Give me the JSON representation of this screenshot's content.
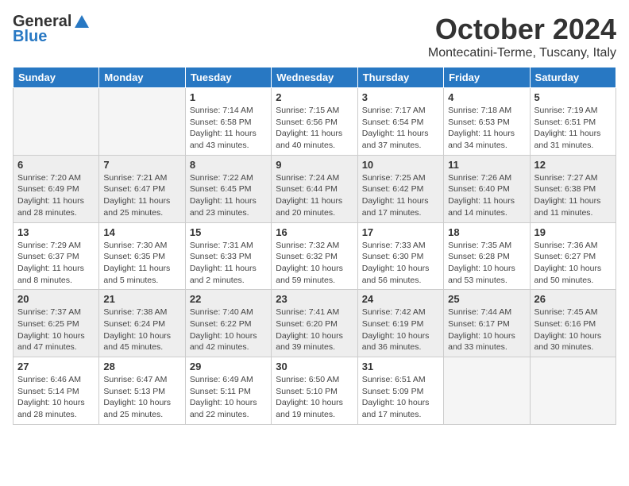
{
  "header": {
    "logo_general": "General",
    "logo_blue": "Blue",
    "month": "October 2024",
    "location": "Montecatini-Terme, Tuscany, Italy"
  },
  "columns": [
    "Sunday",
    "Monday",
    "Tuesday",
    "Wednesday",
    "Thursday",
    "Friday",
    "Saturday"
  ],
  "weeks": [
    [
      {
        "day": "",
        "info": ""
      },
      {
        "day": "",
        "info": ""
      },
      {
        "day": "1",
        "info": "Sunrise: 7:14 AM\nSunset: 6:58 PM\nDaylight: 11 hours and 43 minutes."
      },
      {
        "day": "2",
        "info": "Sunrise: 7:15 AM\nSunset: 6:56 PM\nDaylight: 11 hours and 40 minutes."
      },
      {
        "day": "3",
        "info": "Sunrise: 7:17 AM\nSunset: 6:54 PM\nDaylight: 11 hours and 37 minutes."
      },
      {
        "day": "4",
        "info": "Sunrise: 7:18 AM\nSunset: 6:53 PM\nDaylight: 11 hours and 34 minutes."
      },
      {
        "day": "5",
        "info": "Sunrise: 7:19 AM\nSunset: 6:51 PM\nDaylight: 11 hours and 31 minutes."
      }
    ],
    [
      {
        "day": "6",
        "info": "Sunrise: 7:20 AM\nSunset: 6:49 PM\nDaylight: 11 hours and 28 minutes."
      },
      {
        "day": "7",
        "info": "Sunrise: 7:21 AM\nSunset: 6:47 PM\nDaylight: 11 hours and 25 minutes."
      },
      {
        "day": "8",
        "info": "Sunrise: 7:22 AM\nSunset: 6:45 PM\nDaylight: 11 hours and 23 minutes."
      },
      {
        "day": "9",
        "info": "Sunrise: 7:24 AM\nSunset: 6:44 PM\nDaylight: 11 hours and 20 minutes."
      },
      {
        "day": "10",
        "info": "Sunrise: 7:25 AM\nSunset: 6:42 PM\nDaylight: 11 hours and 17 minutes."
      },
      {
        "day": "11",
        "info": "Sunrise: 7:26 AM\nSunset: 6:40 PM\nDaylight: 11 hours and 14 minutes."
      },
      {
        "day": "12",
        "info": "Sunrise: 7:27 AM\nSunset: 6:38 PM\nDaylight: 11 hours and 11 minutes."
      }
    ],
    [
      {
        "day": "13",
        "info": "Sunrise: 7:29 AM\nSunset: 6:37 PM\nDaylight: 11 hours and 8 minutes."
      },
      {
        "day": "14",
        "info": "Sunrise: 7:30 AM\nSunset: 6:35 PM\nDaylight: 11 hours and 5 minutes."
      },
      {
        "day": "15",
        "info": "Sunrise: 7:31 AM\nSunset: 6:33 PM\nDaylight: 11 hours and 2 minutes."
      },
      {
        "day": "16",
        "info": "Sunrise: 7:32 AM\nSunset: 6:32 PM\nDaylight: 10 hours and 59 minutes."
      },
      {
        "day": "17",
        "info": "Sunrise: 7:33 AM\nSunset: 6:30 PM\nDaylight: 10 hours and 56 minutes."
      },
      {
        "day": "18",
        "info": "Sunrise: 7:35 AM\nSunset: 6:28 PM\nDaylight: 10 hours and 53 minutes."
      },
      {
        "day": "19",
        "info": "Sunrise: 7:36 AM\nSunset: 6:27 PM\nDaylight: 10 hours and 50 minutes."
      }
    ],
    [
      {
        "day": "20",
        "info": "Sunrise: 7:37 AM\nSunset: 6:25 PM\nDaylight: 10 hours and 47 minutes."
      },
      {
        "day": "21",
        "info": "Sunrise: 7:38 AM\nSunset: 6:24 PM\nDaylight: 10 hours and 45 minutes."
      },
      {
        "day": "22",
        "info": "Sunrise: 7:40 AM\nSunset: 6:22 PM\nDaylight: 10 hours and 42 minutes."
      },
      {
        "day": "23",
        "info": "Sunrise: 7:41 AM\nSunset: 6:20 PM\nDaylight: 10 hours and 39 minutes."
      },
      {
        "day": "24",
        "info": "Sunrise: 7:42 AM\nSunset: 6:19 PM\nDaylight: 10 hours and 36 minutes."
      },
      {
        "day": "25",
        "info": "Sunrise: 7:44 AM\nSunset: 6:17 PM\nDaylight: 10 hours and 33 minutes."
      },
      {
        "day": "26",
        "info": "Sunrise: 7:45 AM\nSunset: 6:16 PM\nDaylight: 10 hours and 30 minutes."
      }
    ],
    [
      {
        "day": "27",
        "info": "Sunrise: 6:46 AM\nSunset: 5:14 PM\nDaylight: 10 hours and 28 minutes."
      },
      {
        "day": "28",
        "info": "Sunrise: 6:47 AM\nSunset: 5:13 PM\nDaylight: 10 hours and 25 minutes."
      },
      {
        "day": "29",
        "info": "Sunrise: 6:49 AM\nSunset: 5:11 PM\nDaylight: 10 hours and 22 minutes."
      },
      {
        "day": "30",
        "info": "Sunrise: 6:50 AM\nSunset: 5:10 PM\nDaylight: 10 hours and 19 minutes."
      },
      {
        "day": "31",
        "info": "Sunrise: 6:51 AM\nSunset: 5:09 PM\nDaylight: 10 hours and 17 minutes."
      },
      {
        "day": "",
        "info": ""
      },
      {
        "day": "",
        "info": ""
      }
    ]
  ]
}
